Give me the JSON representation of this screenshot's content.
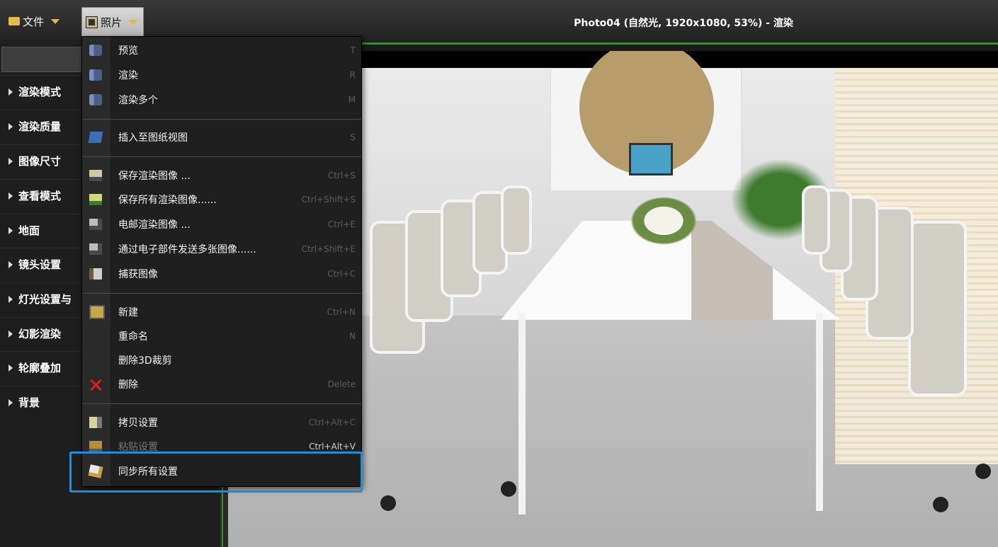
{
  "topbar": {
    "file_menu": "文件",
    "photo_menu": "照片",
    "window_title": "Photo04 (自然光, 1920x1080, 53%) - 渲染"
  },
  "left_panel": {
    "items": [
      {
        "label": "渲染模式"
      },
      {
        "label": "渲染质量"
      },
      {
        "label": "图像尺寸"
      },
      {
        "label": "查看模式"
      },
      {
        "label": "地面"
      },
      {
        "label": "镜头设置"
      },
      {
        "label": "灯光设置与"
      },
      {
        "label": "幻影渲染"
      },
      {
        "label": "轮廓叠加"
      },
      {
        "label": "背景"
      }
    ]
  },
  "photo_menu": {
    "items": [
      {
        "label": "预览",
        "shortcut": "T",
        "icon": "camera-preview-icon"
      },
      {
        "label": "渲染",
        "shortcut": "R",
        "icon": "camera-render-icon"
      },
      {
        "label": "渲染多个",
        "shortcut": "M",
        "icon": "camera-render-multiple-icon"
      },
      {
        "label": "插入至图纸视图",
        "shortcut": "S",
        "icon": "insert-icon"
      },
      {
        "label": "保存渲染图像 ...",
        "shortcut": "Ctrl+S",
        "icon": "save-icon"
      },
      {
        "label": "保存所有渲染图像......",
        "shortcut": "Ctrl+Shift+S",
        "icon": "save-all-icon"
      },
      {
        "label": "电邮渲染图像 ...",
        "shortcut": "Ctrl+E",
        "icon": "email-icon"
      },
      {
        "label": "通过电子部件发送多张图像......",
        "shortcut": "Ctrl+Shift+E",
        "icon": "email-multiple-icon"
      },
      {
        "label": "捕获图像",
        "shortcut": "Ctrl+C",
        "icon": "capture-icon"
      },
      {
        "label": "新建",
        "shortcut": "Ctrl+N",
        "icon": "new-icon"
      },
      {
        "label": "重命名",
        "shortcut": "N",
        "icon": ""
      },
      {
        "label": "删除3D裁剪",
        "shortcut": "",
        "icon": ""
      },
      {
        "label": "删除",
        "shortcut": "Delete",
        "icon": "delete-icon"
      },
      {
        "label": "拷贝设置",
        "shortcut": "Ctrl+Alt+C",
        "icon": "copy-icon"
      },
      {
        "label": "粘贴设置",
        "shortcut": "Ctrl+Alt+V",
        "icon": "paste-icon"
      },
      {
        "label": "同步所有设置",
        "shortcut": "",
        "icon": "sync-icon"
      }
    ]
  },
  "colors": {
    "highlight": "#1e8ed8",
    "accent_green": "#3a8a3a"
  }
}
